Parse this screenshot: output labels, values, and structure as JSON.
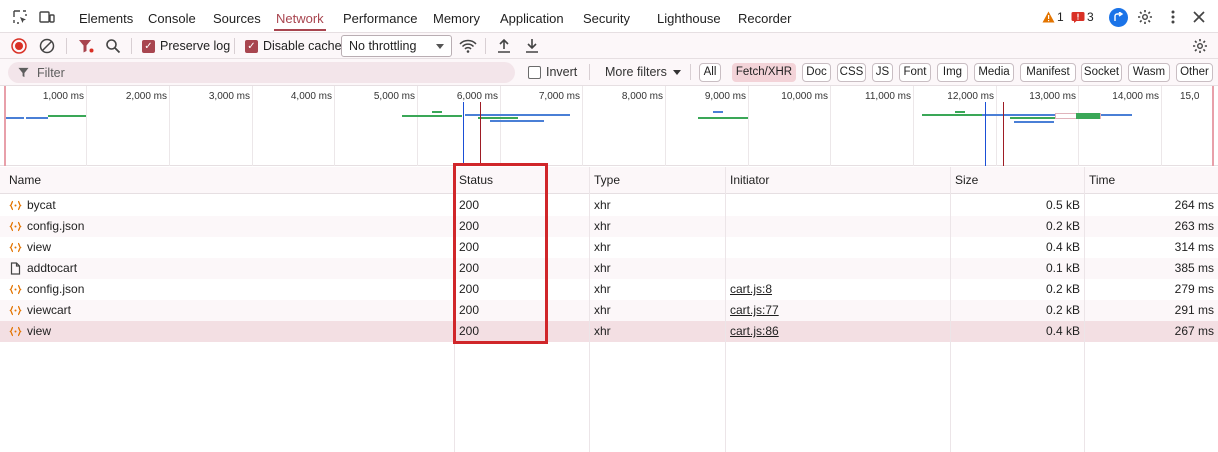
{
  "tabs": [
    "Elements",
    "Console",
    "Sources",
    "Network",
    "Performance",
    "Memory",
    "Application",
    "Security",
    "Lighthouse",
    "Recorder"
  ],
  "active_tab": "Network",
  "badges": {
    "warnings": "1",
    "errors": "3"
  },
  "toolbar": {
    "preserve_log": "Preserve log",
    "disable_cache": "Disable cache",
    "throttling": "No throttling"
  },
  "filter": {
    "placeholder": "Filter",
    "invert": "Invert",
    "more_filters": "More filters",
    "types": [
      "All",
      "Fetch/XHR",
      "Doc",
      "CSS",
      "JS",
      "Font",
      "Img",
      "Media",
      "Manifest",
      "Socket",
      "Wasm",
      "Other"
    ],
    "active_type": "Fetch/XHR"
  },
  "overview": {
    "ticks": [
      "1,000 ms",
      "2,000 ms",
      "3,000 ms",
      "4,000 ms",
      "5,000 ms",
      "6,000 ms",
      "7,000 ms",
      "8,000 ms",
      "9,000 ms",
      "10,000 ms",
      "11,000 ms",
      "12,000 ms",
      "13,000 ms",
      "14,000 ms",
      "15,0"
    ]
  },
  "columns": [
    "Name",
    "Status",
    "Type",
    "Initiator",
    "Size",
    "Time"
  ],
  "rows": [
    {
      "name": "bycat",
      "status": "200",
      "type": "xhr",
      "initiator": "",
      "size": "0.5 kB",
      "time": "264 ms",
      "icon": "xhr-icon"
    },
    {
      "name": "config.json",
      "status": "200",
      "type": "xhr",
      "initiator": "",
      "size": "0.2 kB",
      "time": "263 ms",
      "icon": "xhr-icon"
    },
    {
      "name": "view",
      "status": "200",
      "type": "xhr",
      "initiator": "",
      "size": "0.4 kB",
      "time": "314 ms",
      "icon": "xhr-icon"
    },
    {
      "name": "addtocart",
      "status": "200",
      "type": "xhr",
      "initiator": "",
      "size": "0.1 kB",
      "time": "385 ms",
      "icon": "document-icon"
    },
    {
      "name": "config.json",
      "status": "200",
      "type": "xhr",
      "initiator": "cart.js:8",
      "size": "0.2 kB",
      "time": "279 ms",
      "icon": "xhr-icon"
    },
    {
      "name": "viewcart",
      "status": "200",
      "type": "xhr",
      "initiator": "cart.js:77",
      "size": "0.2 kB",
      "time": "291 ms",
      "icon": "xhr-icon"
    },
    {
      "name": "view",
      "status": "200",
      "type": "xhr",
      "initiator": "cart.js:86",
      "size": "0.4 kB",
      "time": "267 ms",
      "icon": "xhr-icon"
    }
  ],
  "selected_row": 6,
  "colors": {
    "accent": "#a8454f",
    "highlight": "#d0262a",
    "green": "#3aa757",
    "blue": "#4a7fd6"
  }
}
